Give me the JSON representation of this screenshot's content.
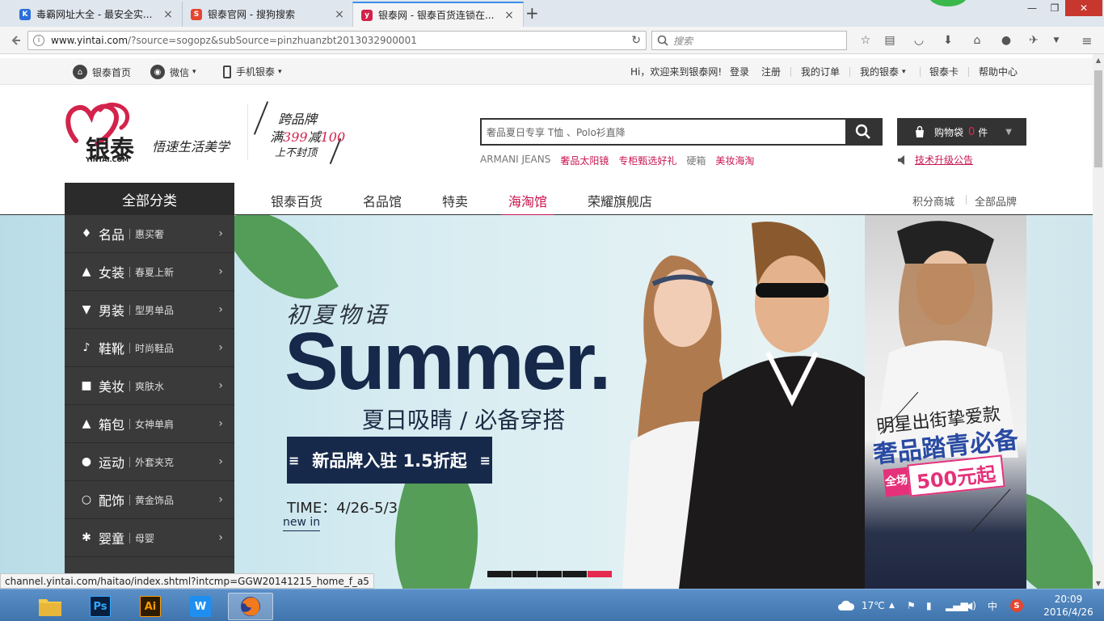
{
  "browser": {
    "tabs": [
      {
        "label": "毒霸网址大全 - 最安全实...",
        "favicon": "K",
        "color": "#2a6fdb"
      },
      {
        "label": "银泰官网 - 搜狗搜索",
        "favicon": "S",
        "color": "#e5452f"
      },
      {
        "label": "银泰网 - 银泰百货连锁在...",
        "favicon": "y",
        "color": "#d3234b",
        "active": true
      }
    ],
    "new_tab": "+",
    "url_host": "www.yintai.com",
    "url_path": "/?source=sogopz&subSource=pinzhuanzbt2013032900001",
    "search_placeholder": "搜索",
    "window_controls": {
      "minimize": "—",
      "restore": "❐",
      "close": "✕"
    }
  },
  "topbar": {
    "home": "银泰首页",
    "wechat": "微信",
    "mobile": "手机银泰",
    "welcome": "Hi，欢迎来到银泰网!",
    "login": "登录",
    "register": "注册",
    "my_orders": "我的订单",
    "my_yintai": "我的银泰",
    "card": "银泰卡",
    "help": "帮助中心"
  },
  "header": {
    "logo_text": "银泰",
    "logo_sub": "YINTAI.COM",
    "slogan": "悟速生活美学",
    "promo_line1": "跨品牌",
    "promo_line2_a": "满",
    "promo_line2_b": "399",
    "promo_line2_c": "减",
    "promo_line2_d": "100",
    "promo_line3": "上不封顶",
    "search_placeholder": "奢品夏日专享 T恤 、Polo衫直降",
    "hot_words": [
      {
        "text": "ARMANI JEANS",
        "style": "gray"
      },
      {
        "text": "奢品太阳镜",
        "style": "red"
      },
      {
        "text": "专柜甄选好礼",
        "style": "red"
      },
      {
        "text": "硬箱",
        "style": "gray"
      },
      {
        "text": "美妆海淘",
        "style": "red"
      }
    ],
    "cart_label": "购物袋",
    "cart_count": "0",
    "cart_unit": "件",
    "notice": "技术升级公告"
  },
  "nav": {
    "all_categories": "全部分类",
    "links": [
      {
        "label": "银泰百货"
      },
      {
        "label": "名品馆"
      },
      {
        "label": "特卖"
      },
      {
        "label": "海淘馆",
        "active": true
      },
      {
        "label": "荣耀旗舰店"
      }
    ],
    "right_links": [
      "积分商城",
      "全部品牌"
    ]
  },
  "categories": [
    {
      "name": "名品",
      "sub": "惠买奢",
      "icon": "diamond-icon",
      "glyph": "♦"
    },
    {
      "name": "女装",
      "sub": "春夏上新",
      "icon": "dress-icon",
      "glyph": "▲"
    },
    {
      "name": "男装",
      "sub": "型男单品",
      "icon": "shirt-icon",
      "glyph": "▼"
    },
    {
      "name": "鞋靴",
      "sub": "时尚鞋品",
      "icon": "boot-icon",
      "glyph": "♪"
    },
    {
      "name": "美妆",
      "sub": "爽肤水",
      "icon": "cosmetics-icon",
      "glyph": "■"
    },
    {
      "name": "箱包",
      "sub": "女神单肩",
      "icon": "bag-icon",
      "glyph": "▲"
    },
    {
      "name": "运动",
      "sub": "外套夹克",
      "icon": "football-icon",
      "glyph": "●"
    },
    {
      "name": "配饰",
      "sub": "黄金饰品",
      "icon": "ring-icon",
      "glyph": "○"
    },
    {
      "name": "婴童",
      "sub": "母婴",
      "icon": "baby-icon",
      "glyph": "✱"
    }
  ],
  "banner": {
    "cn_title": "初夏物语",
    "title": "Summer.",
    "subtitle": "夏日吸睛 / 必备穿搭",
    "strip": "新品牌入驻 1.5折起",
    "time": "TIME：4/26-5/3",
    "new_in": "new in",
    "side_line1": "明星出街挚爱款",
    "side_line2": "奢品踏青必备",
    "side_tag": "全场",
    "side_price": "500元起",
    "slides_total": 5,
    "slide_active": 5
  },
  "status_url": "channel.yintai.com/haitao/index.shtml?intcmp=GGW20141215_home_f_a5",
  "taskbar": {
    "apps": [
      {
        "name": "file-explorer",
        "label": ""
      },
      {
        "name": "photoshop",
        "label": "Ps"
      },
      {
        "name": "illustrator",
        "label": "Ai"
      },
      {
        "name": "wps",
        "label": "W"
      },
      {
        "name": "firefox",
        "label": ""
      }
    ],
    "weather": "17℃",
    "ime": "中",
    "time": "20:09",
    "date": "2016/4/26"
  },
  "colors": {
    "accent": "#c8164f",
    "dark": "#333333",
    "navy": "#16294a"
  }
}
